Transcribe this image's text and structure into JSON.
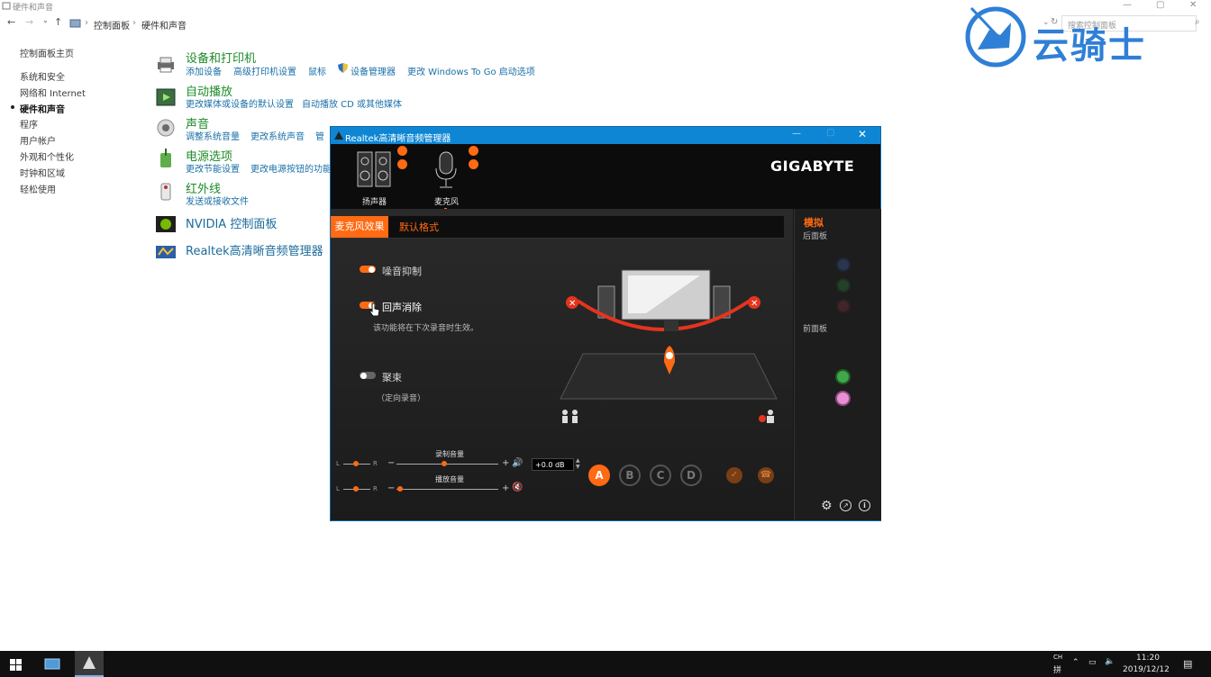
{
  "window": {
    "title": "硬件和声音"
  },
  "nav": {
    "crumb_root": "控制面板",
    "crumb_current": "硬件和声音",
    "search_placeholder": "搜索控制面板"
  },
  "sidebar": {
    "items": [
      {
        "label": "控制面板主页"
      },
      {
        "label": "系统和安全"
      },
      {
        "label": "网络和 Internet"
      },
      {
        "label": "硬件和声音"
      },
      {
        "label": "程序"
      },
      {
        "label": "用户帐户"
      },
      {
        "label": "外观和个性化"
      },
      {
        "label": "时钟和区域"
      },
      {
        "label": "轻松使用"
      }
    ]
  },
  "categories": [
    {
      "title": "设备和打印机",
      "links": [
        "添加设备",
        "高级打印机设置",
        "鼠标",
        "设备管理器",
        "更改 Windows To Go 启动选项"
      ]
    },
    {
      "title": "自动播放",
      "links": [
        "更改媒体或设备的默认设置",
        "自动播放 CD 或其他媒体"
      ]
    },
    {
      "title": "声音",
      "links": [
        "调整系统音量",
        "更改系统声音",
        "管"
      ]
    },
    {
      "title": "电源选项",
      "links": [
        "更改节能设置",
        "更改电源按钮的功能"
      ]
    },
    {
      "title": "红外线",
      "links": [
        "发送或接收文件"
      ]
    },
    {
      "title": "NVIDIA 控制面板",
      "links": []
    },
    {
      "title": "Realtek高清晰音频管理器",
      "links": []
    }
  ],
  "watermark": {
    "text": "云骑士"
  },
  "realtek": {
    "title": "Realtek高清晰音频管理器",
    "brand": "GIGABYTE",
    "devices": [
      {
        "label": "扬声器"
      },
      {
        "label": "麦克风"
      }
    ],
    "tabs": {
      "active": "麦克风效果",
      "other": "默认格式"
    },
    "effects": {
      "noise": "噪音抑制",
      "echo": "回声消除",
      "echo_note": "该功能将在下次录音时生效。",
      "beam": "聚束",
      "beam_note": "（定向录音）"
    },
    "volume": {
      "record_label": "录制音量",
      "play_label": "播放音量",
      "db": "+0.0 dB",
      "l": "L",
      "r": "R",
      "plus": "+",
      "minus": "−"
    },
    "profiles": [
      "A",
      "B",
      "C",
      "D"
    ],
    "right_panel": {
      "analog": "模拟",
      "back": "后面板",
      "front": "前面板"
    },
    "colors": {
      "accent": "#ff6a13",
      "title_bar": "#0e86d4"
    }
  },
  "taskbar": {
    "ime_top": "CH",
    "ime_bottom": "拼",
    "time": "11:20",
    "date": "2019/12/12"
  }
}
